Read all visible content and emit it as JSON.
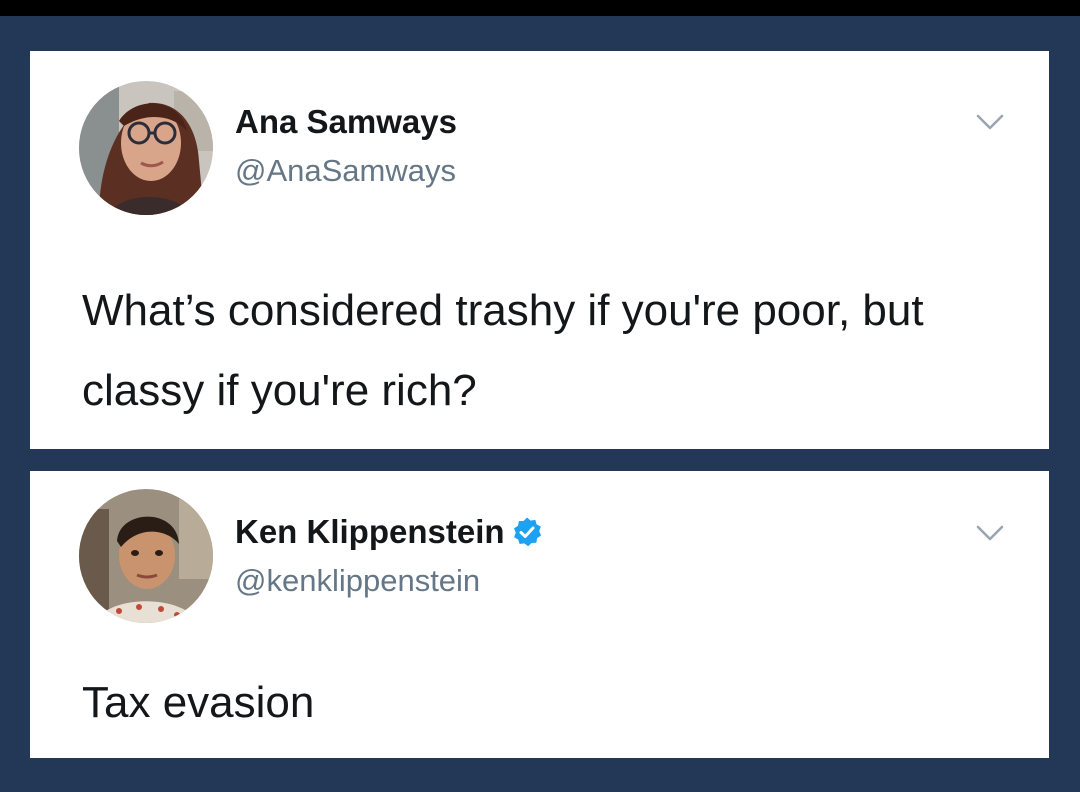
{
  "tweets": [
    {
      "display_name": "Ana Samways",
      "handle": "@AnaSamways",
      "text": "What’s considered trashy if you're poor, but classy if you're rich?",
      "verified": false,
      "avatar_icon": "profile-photo",
      "menu_icon": "chevron-down-icon"
    },
    {
      "display_name": "Ken Klippenstein",
      "handle": "@kenklippenstein",
      "text": "Tax evasion",
      "verified": true,
      "avatar_icon": "profile-photo",
      "menu_icon": "chevron-down-icon"
    }
  ],
  "colors": {
    "background": "#233757",
    "card": "#ffffff",
    "name": "#14171a",
    "handle": "#657786",
    "verified": "#1da1f2"
  }
}
